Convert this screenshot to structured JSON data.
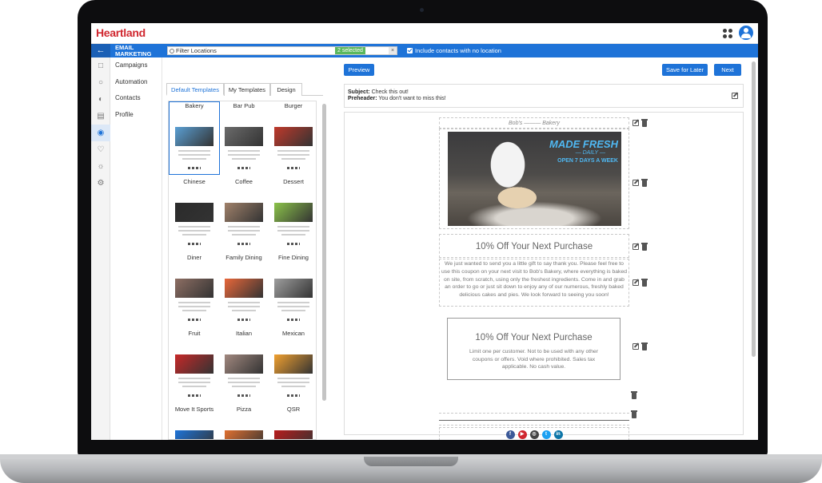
{
  "app": {
    "logo": "Heartland",
    "module_title": "EMAIL MARKETING"
  },
  "filter": {
    "placeholder": "Filter Locations",
    "selected_badge": "2 selected",
    "clear_label": "×",
    "include_label": "Include contacts with no location"
  },
  "submenu": [
    "Campaigns",
    "Automation",
    "Contacts",
    "Profile"
  ],
  "sidenav_icons": [
    "back-arrow-icon",
    "chart-icon",
    "bell-icon",
    "gauge-icon",
    "contact-card-icon",
    "users-icon",
    "heart-icon",
    "lightbulb-icon",
    "settings-icon"
  ],
  "tabs": {
    "default": "Default Templates",
    "mine": "My Templates",
    "design": "Design"
  },
  "templates": [
    {
      "name": "Bakery",
      "color": "#5a9fd4"
    },
    {
      "name": "Bar Pub",
      "color": "#6b6b6b"
    },
    {
      "name": "Burger",
      "color": "#c0392b"
    },
    {
      "name": "Chinese",
      "color": "#2b2b2b"
    },
    {
      "name": "Coffee",
      "color": "#a0816a"
    },
    {
      "name": "Dessert",
      "color": "#8bc34a"
    },
    {
      "name": "Diner",
      "color": "#8d6e63"
    },
    {
      "name": "Family Dining",
      "color": "#e8673a"
    },
    {
      "name": "Fine Dining",
      "color": "#9e9e9e"
    },
    {
      "name": "Fruit",
      "color": "#c62828"
    },
    {
      "name": "Italian",
      "color": "#a1887f"
    },
    {
      "name": "Mexican",
      "color": "#f0a030"
    },
    {
      "name": "Move It Sports",
      "color": "#1e73d8"
    },
    {
      "name": "Pizza",
      "color": "#e07030"
    },
    {
      "name": "QSR",
      "color": "#b71c1c"
    }
  ],
  "toolbar": {
    "preview": "Preview",
    "save": "Save for Later",
    "next": "Next"
  },
  "email": {
    "subject_label": "Subject:",
    "subject_value": "Check this out!",
    "preheader_label": "Preheader:",
    "preheader_value": "You don't want to miss this!",
    "bakery_header": "Bob's ——— Bakery",
    "hero_title": "MADE FRESH",
    "hero_sub": "— DAILY —",
    "hero_sub2": "OPEN 7 DAYS  A WEEK",
    "offer_title": "10% Off Your Next Purchase",
    "body": "We just wanted to send you a little gift to say thank you. Please feel free to use this coupon on your next visit to Bob's Bakery, where everything is baked on site, from scratch, using only the freshest ingredients. Come in and grab an order to go or just sit down to enjoy any of our numerous, freshly baked delicious cakes and pies. We look forward to seeing you soon!",
    "coupon_title": "10% Off Your Next Purchase",
    "coupon_text": "Limit one per customer. Not to be used with any other coupons or offers. Void where prohibited. Sales tax applicable. No cash value."
  },
  "social": [
    {
      "icon": "facebook-icon",
      "glyph": "f",
      "color": "#3b5998"
    },
    {
      "icon": "youtube-icon",
      "glyph": "▶",
      "color": "#d0272f"
    },
    {
      "icon": "instagram-icon",
      "glyph": "◎",
      "color": "#444444"
    },
    {
      "icon": "twitter-icon",
      "glyph": "t",
      "color": "#1da1f2"
    },
    {
      "icon": "linkedin-icon",
      "glyph": "in",
      "color": "#0e76a8"
    }
  ]
}
